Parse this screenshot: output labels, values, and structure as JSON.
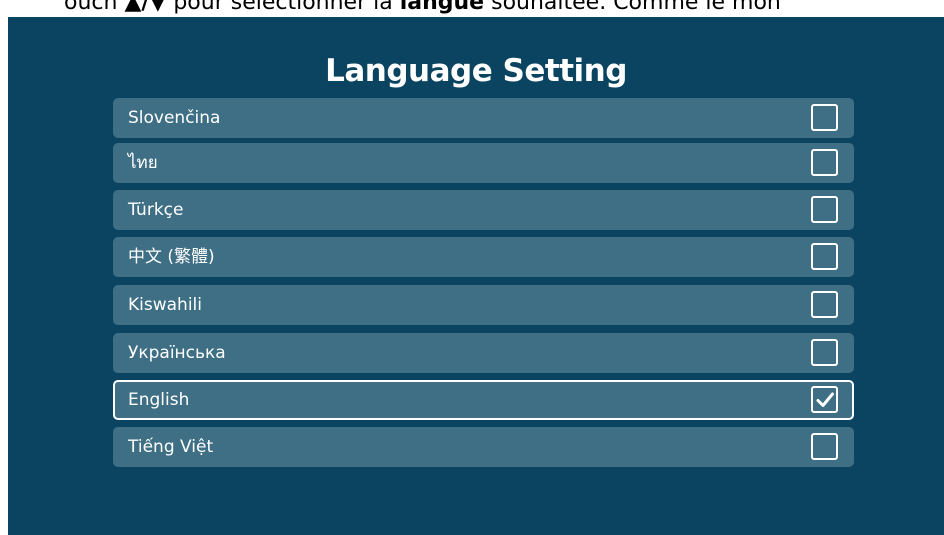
{
  "caption": {
    "prefix": "ouch",
    "key": "▲/▼",
    "middle": " pour sélectionner la ",
    "bold_word": "langue",
    "suffix": " souhaitée. Comme le mon"
  },
  "page": {
    "title": "Language Setting"
  },
  "languages": [
    {
      "label": "Slovenčina",
      "checked": false
    },
    {
      "label": "ไทย",
      "checked": false
    },
    {
      "label": "Türkçe",
      "checked": false
    },
    {
      "label": "中文 (繁體)",
      "checked": false
    },
    {
      "label": "Kiswahili",
      "checked": false
    },
    {
      "label": "Українська",
      "checked": false
    },
    {
      "label": "English",
      "checked": true
    },
    {
      "label": "Tiếng Việt",
      "checked": false
    }
  ],
  "colors": {
    "background": "#0b4460",
    "row": "#3e6f85",
    "text": "#ffffff"
  }
}
